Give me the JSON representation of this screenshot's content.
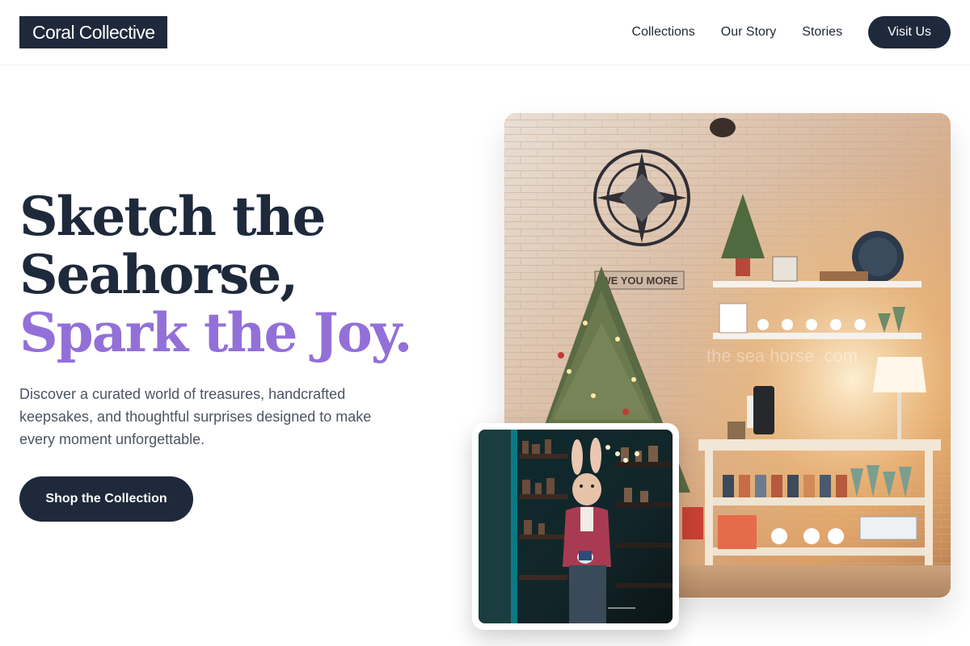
{
  "header": {
    "logo": "Coral Collective",
    "nav": [
      {
        "label": "Collections"
      },
      {
        "label": "Our Story"
      },
      {
        "label": "Stories"
      }
    ],
    "cta": "Visit Us"
  },
  "hero": {
    "title_line1": "Sketch the",
    "title_line2": "Seahorse,",
    "title_accent": "Spark the Joy.",
    "description": "Discover a curated world of treasures, handcrafted keepsakes, and thoughtful surprises designed to make every moment unforgettable.",
    "button": "Shop the Collection"
  },
  "images": {
    "main_sign": "WE YOU MORE",
    "main_watermark": "the sea horse .com"
  },
  "colors": {
    "primary": "#1e293b",
    "accent": "#9370d8",
    "text_muted": "#4b5563"
  }
}
